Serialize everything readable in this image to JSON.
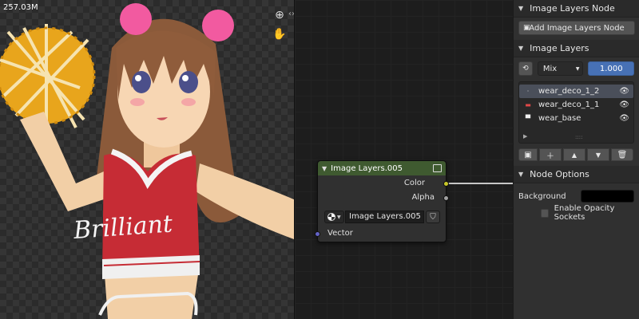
{
  "viewer": {
    "memory_label": "257.03M",
    "shirt_text": "Brilliant"
  },
  "node": {
    "title": "Image Layers.005",
    "outputs": [
      "Color",
      "Alpha"
    ],
    "image_name": "Image Layers.005",
    "input_vector": "Vector",
    "header_color": "#3f5a30",
    "color_socket_color": "#c7c729",
    "alpha_socket_color": "#a1a1a1",
    "vector_socket_color": "#6363c7"
  },
  "sidebar": {
    "panel1": {
      "title": "Image Layers Node",
      "button": "Add Image Layers Node"
    },
    "panel2": {
      "title": "Image Layers",
      "blend_mode": "Mix",
      "opacity": "1.000",
      "layers": [
        {
          "name": "wear_deco_1_2",
          "active": true
        },
        {
          "name": "wear_deco_1_1",
          "active": false
        },
        {
          "name": "wear_base",
          "active": false
        }
      ]
    },
    "panel3": {
      "title": "Node Options",
      "background_label": "Background",
      "background_color": "#000000",
      "opacity_sockets_label": "Enable Opacity Sockets"
    }
  }
}
